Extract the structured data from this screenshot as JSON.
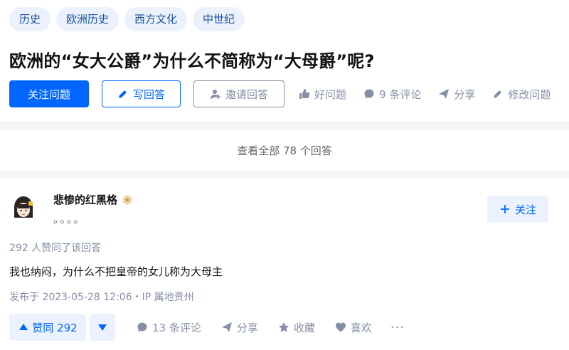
{
  "tags": [
    "历史",
    "欧洲历史",
    "西方文化",
    "中世纪"
  ],
  "question": {
    "title": "欧洲的“女大公爵”为什么不简称为“大母爵”呢?",
    "follow_button": "关注问题",
    "write_answer_button": "写回答",
    "invite_button": "邀请回答",
    "good_question": "好问题",
    "comments": "9 条评论",
    "share": "分享",
    "edit": "修改问题"
  },
  "view_all": "查看全部 78 个回答",
  "answer": {
    "author": "悲惨的红黑格",
    "bio": "。。。。",
    "follow_button": "关注",
    "likes_summary": "292 人赞同了该回答",
    "content": "我也纳闷，为什么不把皇帝的女儿称为大母主",
    "date": "发布于 2023-05-28 12:06・IP 属地贵州",
    "vote_label": "赞同 292",
    "comments": "13 条评论",
    "share": "分享",
    "collect": "收藏",
    "like": "喜欢",
    "more": "···"
  },
  "colors": {
    "accent": "#0066ff",
    "tag_bg": "#ebf2fd",
    "tag_text": "#175199",
    "muted": "#8590a6",
    "page_bg": "#f6f6f6"
  }
}
